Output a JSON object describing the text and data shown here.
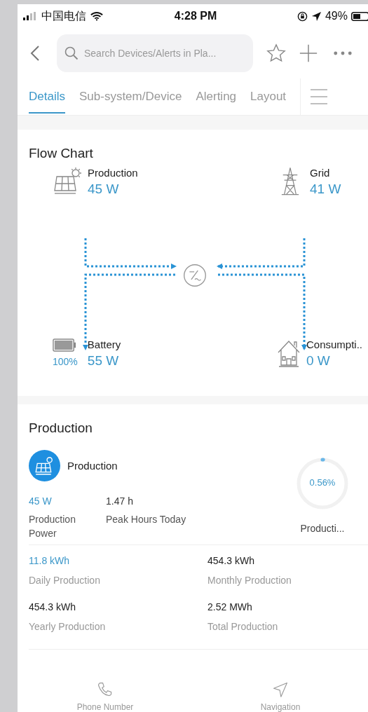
{
  "status_bar": {
    "carrier": "中国电信",
    "time": "4:28 PM",
    "battery": "49%"
  },
  "search": {
    "placeholder": "Search Devices/Alerts in Pla..."
  },
  "tabs": [
    {
      "label": "Details",
      "selected": true
    },
    {
      "label": "Sub-system/Device",
      "selected": false
    },
    {
      "label": "Alerting",
      "selected": false
    },
    {
      "label": "Layout",
      "selected": false
    }
  ],
  "flow_chart": {
    "title": "Flow Chart",
    "nodes": [
      {
        "kind": "production",
        "label": "Production",
        "value": "45 W"
      },
      {
        "kind": "grid",
        "label": "Grid",
        "value": "41 W"
      },
      {
        "kind": "battery",
        "label": "Battery",
        "value": "55 W",
        "percent": "100%"
      },
      {
        "kind": "consumption",
        "label": "Consumpti..",
        "value": "0 W"
      }
    ]
  },
  "production": {
    "title": "Production",
    "header": "Production",
    "gauge": {
      "reading": "0.56%",
      "label": "Producti..."
    },
    "metrics": [
      {
        "value": "45 W",
        "label": "Production Power",
        "highlight": true
      },
      {
        "value": "1.47 h",
        "label": "Peak Hours Today",
        "highlight": false
      }
    ],
    "totals": [
      {
        "value": "11.8 kWh",
        "label": "Daily Production",
        "highlight": true
      },
      {
        "value": "454.3 kWh",
        "label": "Monthly Production",
        "highlight": false
      },
      {
        "value": "454.3 kWh",
        "label": "Yearly Production",
        "highlight": false
      },
      {
        "value": "2.52 MWh",
        "label": "Total Production",
        "highlight": false
      }
    ]
  },
  "bottom_bar": [
    {
      "kind": "phone",
      "label": "Phone Number"
    },
    {
      "kind": "navigation",
      "label": "Navigation"
    }
  ]
}
